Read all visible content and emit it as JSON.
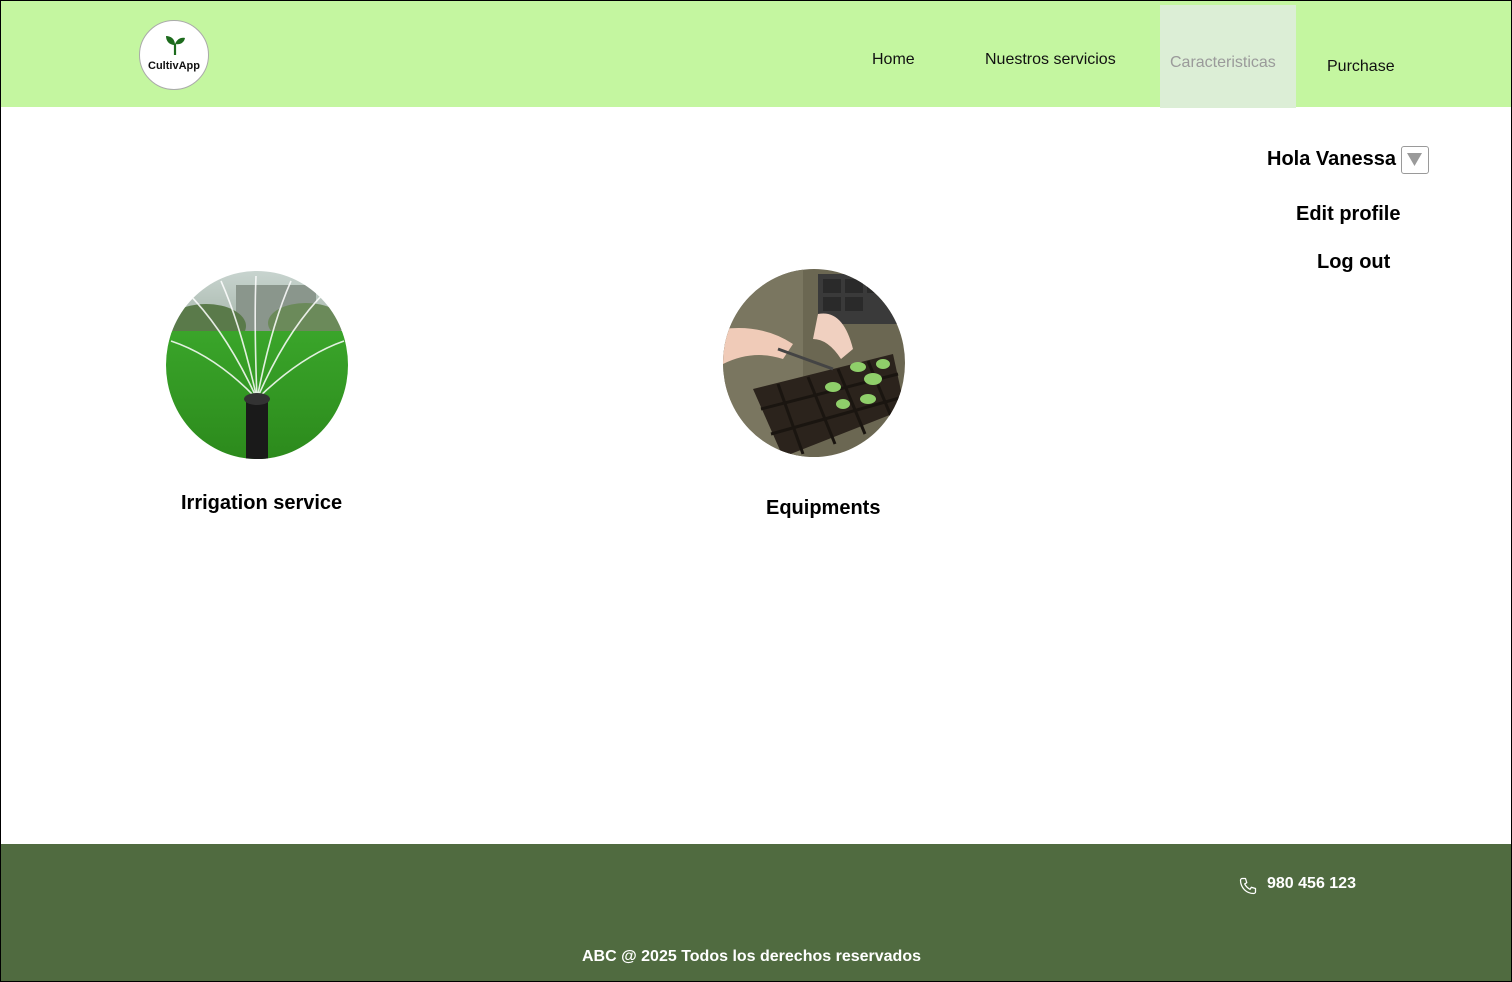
{
  "brand": {
    "name": "CultivApp"
  },
  "nav": {
    "home": "Home",
    "servicios": "Nuestros servicios",
    "caracteristicas": "Caracteristicas",
    "purchase": "Purchase",
    "active": "Caracteristicas"
  },
  "user_menu": {
    "greeting": "Hola Vanessa",
    "edit_profile": "Edit profile",
    "logout": "Log out"
  },
  "services": [
    {
      "label": "Irrigation service",
      "image": "sprinkler-on-lawn-photo"
    },
    {
      "label": "Equipments",
      "image": "seedling-tray-photo"
    }
  ],
  "footer": {
    "phone": "980 456 123",
    "copyright": "ABC @ 2025 Todos los derechos reservados"
  },
  "colors": {
    "header_bg": "#c4f6a0",
    "footer_bg": "#506b40",
    "active_nav_bg": "#dceed6"
  },
  "icons": [
    "seedling-logo-icon",
    "dropdown-arrow-icon",
    "phone-icon"
  ]
}
